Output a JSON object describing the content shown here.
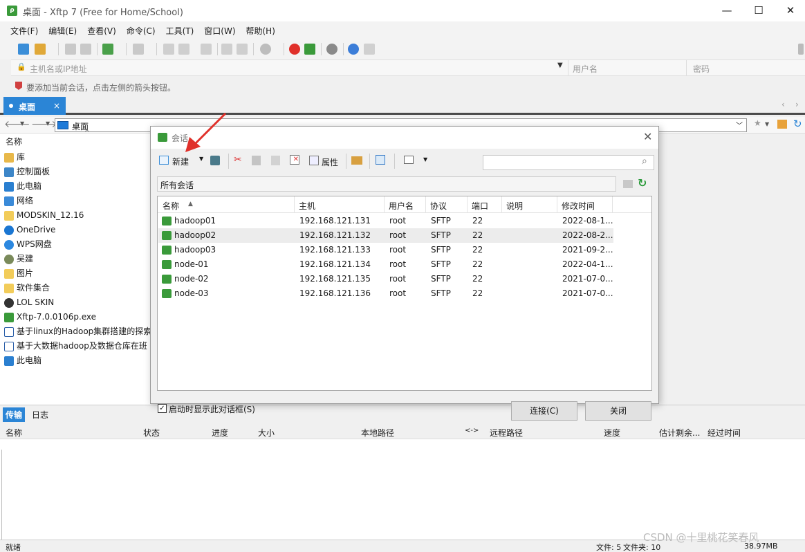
{
  "window": {
    "title": "桌面 - Xftp 7 (Free for Home/School)",
    "app_icon": "xftp-icon"
  },
  "menu": [
    "文件(F)",
    "编辑(E)",
    "查看(V)",
    "命令(C)",
    "工具(T)",
    "窗口(W)",
    "帮助(H)"
  ],
  "address": {
    "host_placeholder": "主机名或IP地址",
    "user_placeholder": "用户名",
    "pass_placeholder": "密码"
  },
  "hint": "要添加当前会话，点击左侧的箭头按钮。",
  "tab": {
    "label": "桌面",
    "close": "×"
  },
  "nav": {
    "path": "桌面"
  },
  "left_pane": {
    "header": "名称",
    "items": [
      {
        "label": "库",
        "icon": "library-icon"
      },
      {
        "label": "控制面板",
        "icon": "control-panel-icon"
      },
      {
        "label": "此电脑",
        "icon": "computer-icon"
      },
      {
        "label": "网络",
        "icon": "network-icon"
      },
      {
        "label": "MODSKIN_12.16",
        "icon": "folder-icon"
      },
      {
        "label": "OneDrive",
        "icon": "cloud-icon"
      },
      {
        "label": "WPS网盘",
        "icon": "cloud-icon"
      },
      {
        "label": "吴建",
        "icon": "user-icon"
      },
      {
        "label": "图片",
        "icon": "folder-icon"
      },
      {
        "label": "软件集合",
        "icon": "folder-icon"
      },
      {
        "label": "LOL SKIN",
        "icon": "app-icon"
      },
      {
        "label": "Xftp-7.0.0106p.exe",
        "icon": "xftp-icon"
      },
      {
        "label": "基于linux的Hadoop集群搭建的探索",
        "icon": "document-icon"
      },
      {
        "label": "基于大数据hadoop及数据仓库在班",
        "icon": "document-icon"
      },
      {
        "label": "此电脑",
        "icon": "computer-icon"
      }
    ]
  },
  "transfer": {
    "tabs": [
      "传输",
      "日志"
    ],
    "columns": [
      "名称",
      "状态",
      "进度",
      "大小",
      "本地路径",
      "<->",
      "远程路径",
      "速度",
      "估计剩余...",
      "经过时间"
    ]
  },
  "status": {
    "left": "就绪",
    "files": "文件: 5",
    "folders": "文件夹: 10",
    "size": "38.97MB",
    "watermark": "CSDN @十里桃花笑春风"
  },
  "dialog": {
    "title": "会话",
    "new_label": "新建",
    "props_label": "属性",
    "path_label": "所有会话",
    "columns": [
      "名称",
      "主机",
      "用户名",
      "协议",
      "端口",
      "说明",
      "修改时间"
    ],
    "sessions": [
      {
        "name": "hadoop01",
        "host": "192.168.121.131",
        "user": "root",
        "proto": "SFTP",
        "port": "22",
        "desc": "",
        "modified": "2022-08-1..."
      },
      {
        "name": "hadoop02",
        "host": "192.168.121.132",
        "user": "root",
        "proto": "SFTP",
        "port": "22",
        "desc": "",
        "modified": "2022-08-2..."
      },
      {
        "name": "hadoop03",
        "host": "192.168.121.133",
        "user": "root",
        "proto": "SFTP",
        "port": "22",
        "desc": "",
        "modified": "2021-09-2..."
      },
      {
        "name": "node-01",
        "host": "192.168.121.134",
        "user": "root",
        "proto": "SFTP",
        "port": "22",
        "desc": "",
        "modified": "2022-04-1..."
      },
      {
        "name": "node-02",
        "host": "192.168.121.135",
        "user": "root",
        "proto": "SFTP",
        "port": "22",
        "desc": "",
        "modified": "2021-07-0..."
      },
      {
        "name": "node-03",
        "host": "192.168.121.136",
        "user": "root",
        "proto": "SFTP",
        "port": "22",
        "desc": "",
        "modified": "2021-07-0..."
      }
    ],
    "show_on_start": "启动时显示此对话框(S)",
    "connect": "连接(C)",
    "close": "关闭"
  },
  "colors": {
    "accent": "#2b85d6",
    "xftp_green": "#3a9a3a",
    "arrow_red": "#e0302a"
  }
}
